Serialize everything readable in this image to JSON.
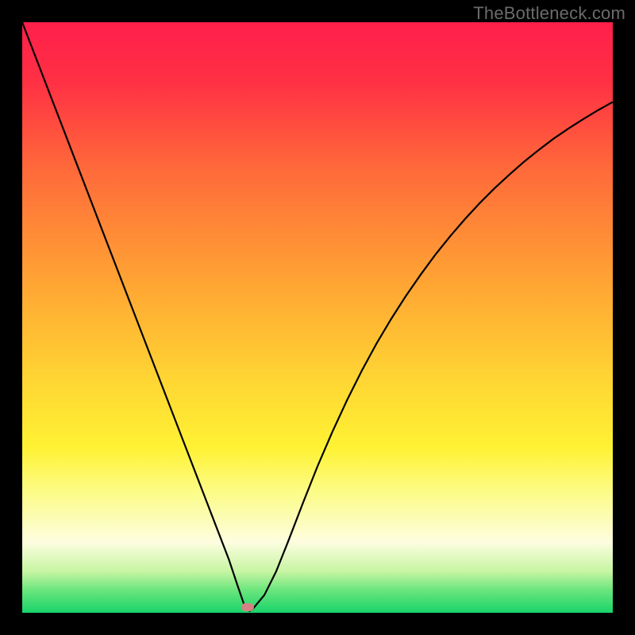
{
  "watermark": {
    "text": "TheBottleneck.com"
  },
  "chart_data": {
    "type": "line",
    "title": "",
    "xlabel": "",
    "ylabel": "",
    "xlim": [
      0,
      100
    ],
    "ylim": [
      0,
      100
    ],
    "grid": false,
    "legend": false,
    "background_gradient": {
      "stops": [
        {
          "pct": 0,
          "color": "#ff1f4b"
        },
        {
          "pct": 10,
          "color": "#ff3044"
        },
        {
          "pct": 25,
          "color": "#ff6a3a"
        },
        {
          "pct": 45,
          "color": "#ffa733"
        },
        {
          "pct": 60,
          "color": "#ffd433"
        },
        {
          "pct": 72,
          "color": "#fff233"
        },
        {
          "pct": 80,
          "color": "#fcfc8c"
        },
        {
          "pct": 88,
          "color": "#fdfde0"
        },
        {
          "pct": 93,
          "color": "#c7f5a3"
        },
        {
          "pct": 96,
          "color": "#6fe67e"
        },
        {
          "pct": 100,
          "color": "#18d46a"
        }
      ]
    },
    "series": [
      {
        "name": "bottleneck-curve",
        "color": "#000000",
        "x": [
          0,
          2.5,
          5,
          7.5,
          10,
          12.5,
          15,
          17.5,
          20,
          22.5,
          25,
          27.5,
          30,
          32.5,
          35,
          36.5,
          37.5,
          38,
          38.5,
          39,
          41,
          43,
          45,
          47.5,
          50,
          52.5,
          55,
          57.5,
          60,
          62.5,
          65,
          67.5,
          70,
          72.5,
          75,
          77.5,
          80,
          82.5,
          85,
          87.5,
          90,
          92.5,
          95,
          97.5,
          100
        ],
        "y": [
          100,
          93.5,
          87,
          80.5,
          74,
          67.5,
          61,
          54.5,
          48,
          41.5,
          35,
          28.5,
          22,
          15.5,
          9,
          4.5,
          1.6,
          0.6,
          0.3,
          0.6,
          3,
          7,
          12,
          18.5,
          24.8,
          30.6,
          36,
          41,
          45.6,
          49.8,
          53.7,
          57.3,
          60.7,
          63.8,
          66.7,
          69.4,
          71.9,
          74.2,
          76.4,
          78.4,
          80.3,
          82.0,
          83.6,
          85.1,
          86.5
        ]
      }
    ],
    "marker": {
      "x_pct": 38.2,
      "y_pct_from_bottom": 0.9,
      "color": "#d68183"
    }
  }
}
